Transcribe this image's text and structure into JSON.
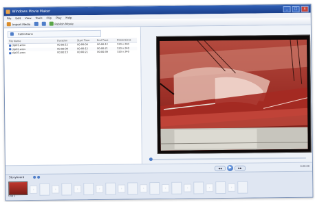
{
  "window": {
    "title": "Windows Movie Maker",
    "controls": [
      "_",
      "□",
      "x"
    ]
  },
  "menu": [
    "File",
    "Edit",
    "View",
    "Tools",
    "Clip",
    "Play",
    "Help"
  ],
  "toolbar": {
    "import_label": "Import Media",
    "publish_label": "Publish Movie"
  },
  "library": {
    "breadcrumb": "Collections",
    "columns": [
      "File Name",
      "Duration",
      "Start Time",
      "End Time",
      "Dimensions"
    ],
    "rows": [
      {
        "name": "clip01.wmv",
        "duration": "00:00:12",
        "start": "00:00:00",
        "end": "00:00:12",
        "dims": "320 x 240"
      },
      {
        "name": "clip02.wmv",
        "duration": "00:00:09",
        "start": "00:00:12",
        "end": "00:00:21",
        "dims": "320 x 240"
      },
      {
        "name": "clip03.wmv",
        "duration": "00:00:15",
        "start": "00:00:21",
        "end": "00:00:36",
        "dims": "320 x 240"
      }
    ]
  },
  "preview": {
    "position": 0.0
  },
  "playback": {
    "prev_label": "◀◀",
    "play_label": "▶",
    "next_label": "▶▶",
    "timecode": "0:00:00"
  },
  "storyboard": {
    "label": "Storyboard",
    "first_clip_label": "Clip 1",
    "empty_slots": 10
  },
  "colors": {
    "accent": "#2c5fb4",
    "titlebar": "#1b3f8a"
  }
}
